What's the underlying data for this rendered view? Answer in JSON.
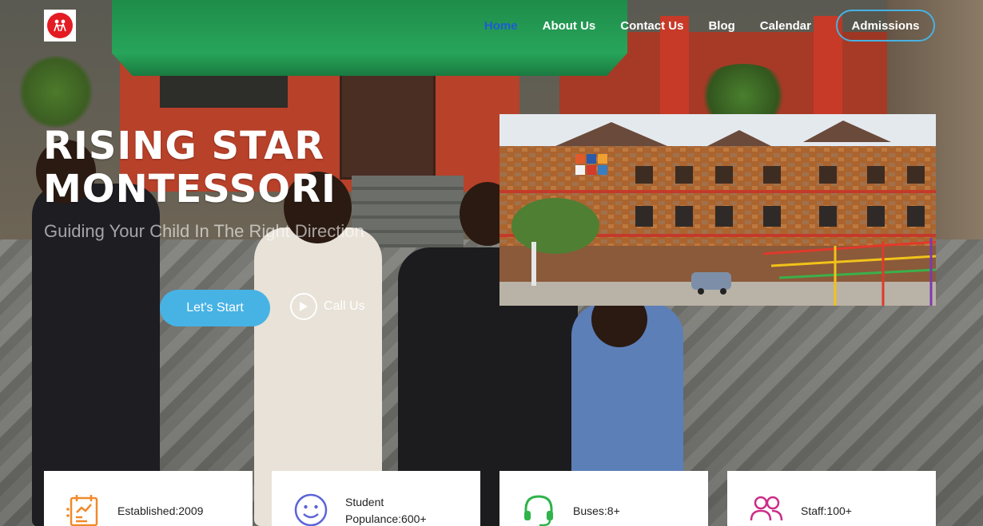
{
  "logo": {
    "alt": "Rising Star Montessori logo"
  },
  "nav": {
    "items": [
      {
        "label": "Home",
        "active": true
      },
      {
        "label": "About Us",
        "active": false
      },
      {
        "label": "Contact Us",
        "active": false
      },
      {
        "label": "Blog",
        "active": false
      },
      {
        "label": "Calendar",
        "active": false
      }
    ],
    "cta": "Admissions"
  },
  "hero": {
    "title_line1": "RISING STAR",
    "title_line2": "MONTESSORI",
    "subtitle": "Guiding Your Child In The Right Direction",
    "start_button": "Let's Start",
    "call_button": "Call Us"
  },
  "stats": [
    {
      "icon": "chart-board-icon",
      "label": "Established:2009",
      "color": "#f08a2b"
    },
    {
      "icon": "smiley-icon",
      "label": "Student Populance:600+",
      "color": "#5b64d8"
    },
    {
      "icon": "headset-icon",
      "label": "Buses:8+",
      "color": "#2fb34a"
    },
    {
      "icon": "users-icon",
      "label": "Staff:100+",
      "color": "#cc2b88"
    }
  ],
  "colors": {
    "accent": "#47b2e4",
    "active_nav": "#1e5bd6"
  }
}
